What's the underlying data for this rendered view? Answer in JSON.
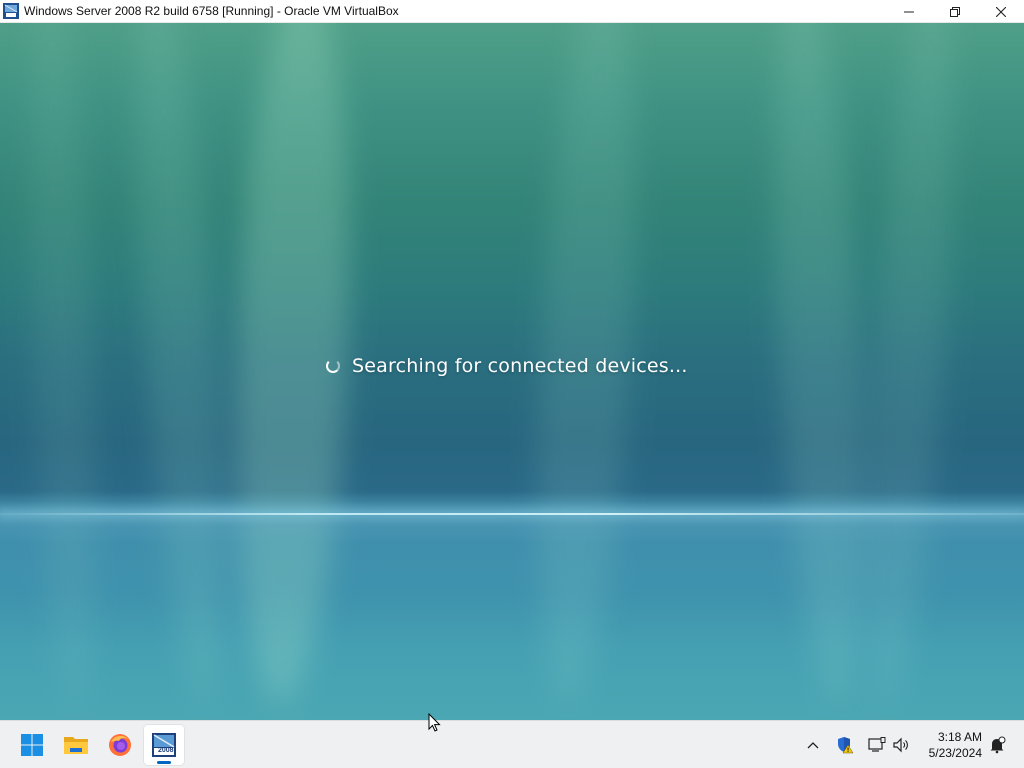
{
  "window": {
    "title": "Windows Server 2008 R2 build 6758 [Running] - Oracle VM VirtualBox",
    "app_icon": "virtualbox-vm-icon",
    "controls": [
      "minimize-icon",
      "restore-icon",
      "close-icon"
    ]
  },
  "vm": {
    "status_text": "Searching for connected devices...",
    "spinner_icon": "loading-spinner-icon"
  },
  "taskbar": {
    "apps": [
      {
        "name": "start-button",
        "icon": "windows-logo-icon"
      },
      {
        "name": "file-explorer",
        "icon": "folder-icon"
      },
      {
        "name": "firefox",
        "icon": "firefox-icon"
      },
      {
        "name": "virtualbox-vm",
        "icon": "windows-server-2008-icon",
        "label": "2008",
        "active": true
      }
    ],
    "tray": {
      "icons": [
        "chevron-up-icon",
        "security-warning-icon",
        "network-icon",
        "volume-icon"
      ],
      "time": "3:18 AM",
      "date": "5/23/2024",
      "notification_icon": "notification-bell-icon"
    }
  },
  "colors": {
    "accent": "#0067c0",
    "background_top": "#4f9f88",
    "background_mid": "#28667f",
    "background_bottom": "#4ba7b3"
  }
}
